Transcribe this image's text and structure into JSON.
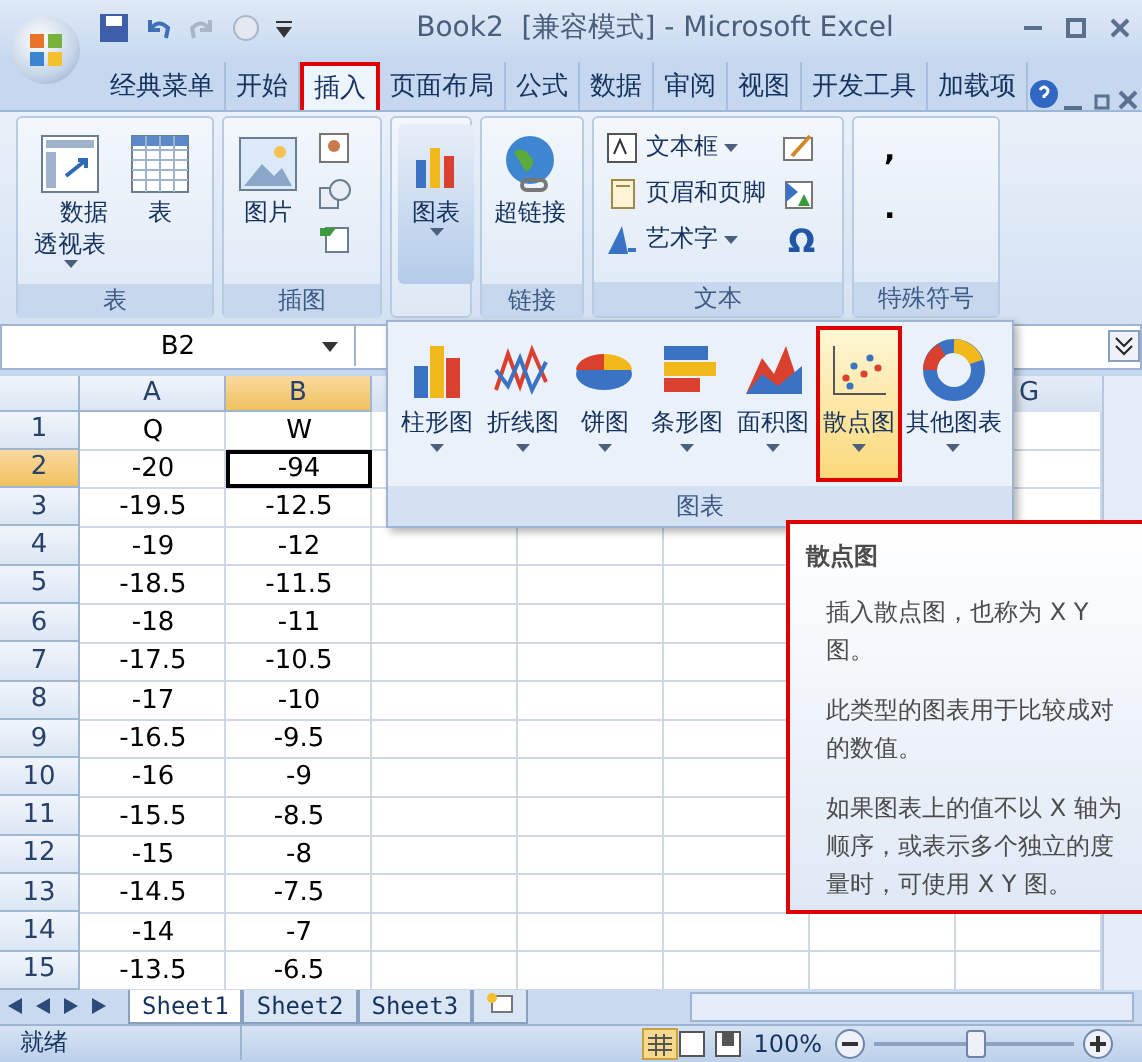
{
  "window": {
    "title": "Book2  [兼容模式] - Microsoft Excel"
  },
  "tabs": [
    {
      "label": "经典菜单",
      "selected": false
    },
    {
      "label": "开始",
      "selected": false
    },
    {
      "label": "插入",
      "selected": true
    },
    {
      "label": "页面布局",
      "selected": false
    },
    {
      "label": "公式",
      "selected": false
    },
    {
      "label": "数据",
      "selected": false
    },
    {
      "label": "审阅",
      "selected": false
    },
    {
      "label": "视图",
      "selected": false
    },
    {
      "label": "开发工具",
      "selected": false
    },
    {
      "label": "加载项",
      "selected": false
    }
  ],
  "ribbon_groups": [
    {
      "label": "表",
      "buttons": [
        {
          "kind": "large",
          "label": "数据透视表",
          "dropdown": true,
          "pressed": false
        },
        {
          "kind": "large",
          "label": "表",
          "dropdown": false,
          "pressed": false
        }
      ]
    },
    {
      "label": "插图",
      "buttons": [
        {
          "kind": "large",
          "label": "图片",
          "dropdown": false,
          "pressed": false
        },
        {
          "kind": "iconcol"
        }
      ]
    },
    {
      "buttons": [
        {
          "kind": "large",
          "label": "图表",
          "dropdown": true,
          "pressed": true
        }
      ]
    },
    {
      "label": "链接",
      "buttons": [
        {
          "kind": "large",
          "label": "超链接",
          "dropdown": false,
          "pressed": false
        }
      ]
    },
    {
      "label": "文本",
      "buttons": [
        {
          "kind": "smallcol",
          "items": [
            {
              "label": "文本框",
              "dropdown": true
            },
            {
              "label": "页眉和页脚",
              "dropdown": false
            },
            {
              "label": "艺术字",
              "dropdown": true
            }
          ]
        },
        {
          "kind": "symbolcol",
          "symbol": "Ω"
        }
      ]
    },
    {
      "label": "特殊符号",
      "buttons": [
        {
          "kind": "marks",
          "items": [
            ",",
            "."
          ]
        }
      ]
    }
  ],
  "name_box": "B2",
  "columns": [
    {
      "label": "A",
      "selected": false
    },
    {
      "label": "B",
      "selected": true
    }
  ],
  "column_7": {
    "label": "G"
  },
  "rows": [
    {
      "number": "1",
      "selected": false,
      "cells": [
        "Q",
        "W"
      ]
    },
    {
      "number": "2",
      "selected": true,
      "cells": [
        "-20",
        "-94"
      ]
    },
    {
      "number": "3",
      "selected": false,
      "cells": [
        "-19.5",
        "-12.5"
      ]
    },
    {
      "number": "4",
      "selected": false,
      "cells": [
        "-19",
        "-12"
      ]
    },
    {
      "number": "5",
      "selected": false,
      "cells": [
        "-18.5",
        "-11.5"
      ]
    },
    {
      "number": "6",
      "selected": false,
      "cells": [
        "-18",
        "-11"
      ]
    },
    {
      "number": "7",
      "selected": false,
      "cells": [
        "-17.5",
        "-10.5"
      ]
    },
    {
      "number": "8",
      "selected": false,
      "cells": [
        "-17",
        "-10"
      ]
    },
    {
      "number": "9",
      "selected": false,
      "cells": [
        "-16.5",
        "-9.5"
      ]
    },
    {
      "number": "10",
      "selected": false,
      "cells": [
        "-16",
        "-9"
      ]
    },
    {
      "number": "11",
      "selected": false,
      "cells": [
        "-15.5",
        "-8.5"
      ]
    },
    {
      "number": "12",
      "selected": false,
      "cells": [
        "-15",
        "-8"
      ]
    },
    {
      "number": "13",
      "selected": false,
      "cells": [
        "-14.5",
        "-7.5"
      ]
    },
    {
      "number": "14",
      "selected": false,
      "cells": [
        "-14",
        "-7"
      ]
    },
    {
      "number": "15",
      "selected": false,
      "cells": [
        "-13.5",
        "-6.5"
      ]
    }
  ],
  "chart_menu": {
    "label": "图表",
    "items": [
      {
        "label": "柱形图",
        "selected": false
      },
      {
        "label": "折线图",
        "selected": false
      },
      {
        "label": "饼图",
        "selected": false
      },
      {
        "label": "条形图",
        "selected": false
      },
      {
        "label": "面积图",
        "selected": false
      },
      {
        "label": "散点图",
        "selected": true
      },
      {
        "label": "其他图表",
        "selected": false
      }
    ]
  },
  "tooltip": {
    "title": "散点图",
    "paragraphs": [
      "插入散点图，也称为 X Y 图。",
      "此类型的图表用于比较成对的数值。",
      "如果图表上的值不以 X 轴为顺序，或表示多个独立的度量时，可使用 X Y 图。"
    ]
  },
  "sheets": [
    {
      "label": "Sheet1",
      "selected": true
    },
    {
      "label": "Sheet2",
      "selected": false
    },
    {
      "label": "Sheet3",
      "selected": false
    }
  ],
  "status_bar": {
    "status": "就绪",
    "zoom": "100%",
    "level": 0.5
  }
}
